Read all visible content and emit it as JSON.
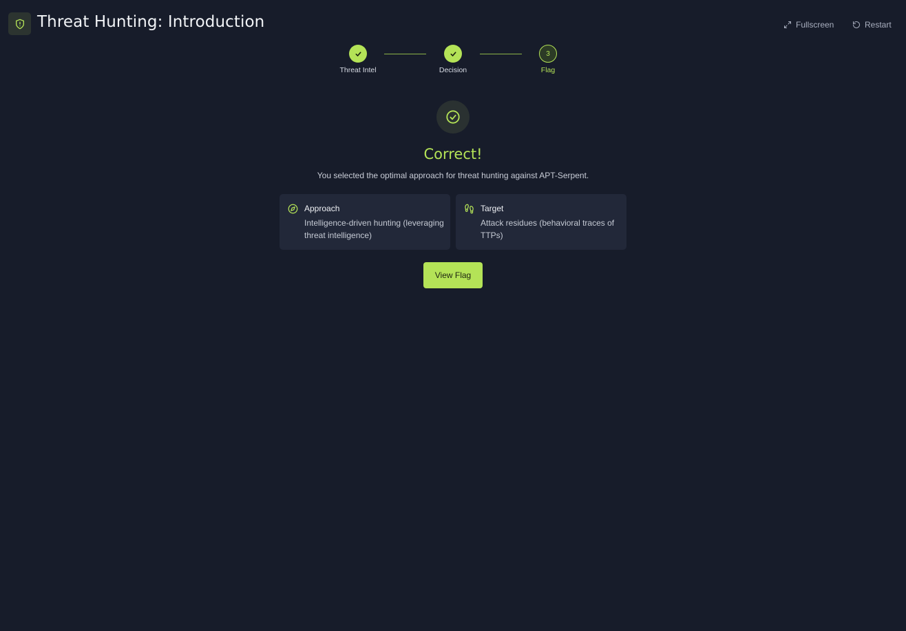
{
  "header": {
    "title": "Threat Hunting: Introduction",
    "logo_icon": "shield-alert-icon",
    "fullscreen_label": "Fullscreen",
    "restart_label": "Restart"
  },
  "stepper": {
    "steps": [
      {
        "label": "Threat Intel",
        "status": "done"
      },
      {
        "label": "Decision",
        "status": "done"
      },
      {
        "label": "Flag",
        "status": "current",
        "number": "3"
      }
    ]
  },
  "result": {
    "title": "Correct!",
    "subtitle": "You selected the optimal approach for threat hunting against APT-Serpent.",
    "cards": [
      {
        "label": "Approach",
        "value": "Intelligence-driven hunting (leveraging threat intelligence)",
        "icon": "compass-icon"
      },
      {
        "label": "Target",
        "value": "Attack residues (behavioral traces of TTPs)",
        "icon": "footprints-icon"
      }
    ],
    "button_label": "View Flag"
  },
  "colors": {
    "accent": "#b4e357",
    "background": "#171c2a",
    "card": "#222839"
  }
}
